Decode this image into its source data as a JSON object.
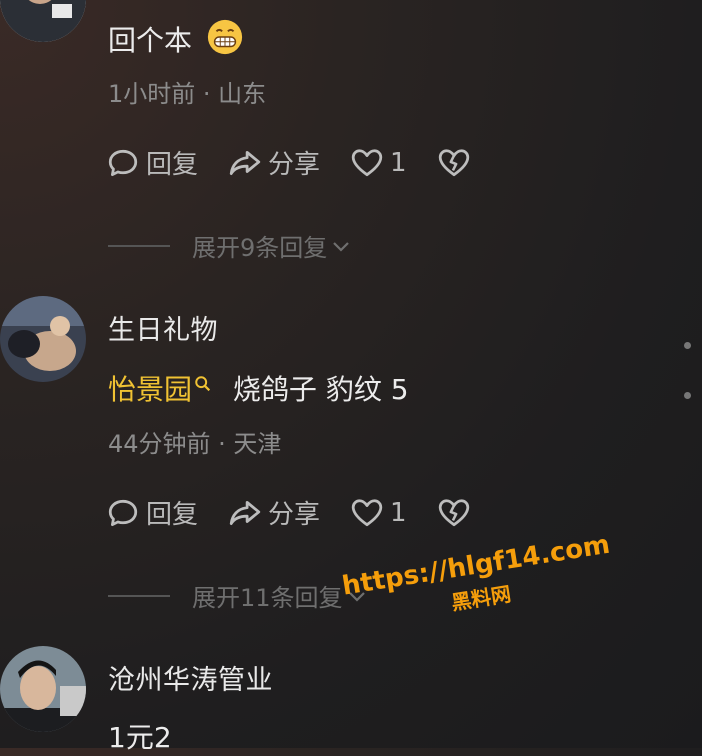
{
  "comments": [
    {
      "username": "",
      "content": "回个本",
      "meta": "1小时前 · 山东",
      "actions": {
        "reply": "回复",
        "share": "分享",
        "likes": "1"
      },
      "expand": "展开9条回复"
    },
    {
      "username": "生日礼物",
      "content_link": "怡景园",
      "content_rest": "烧鸽子 豹纹 5",
      "meta": "44分钟前 · 天津",
      "actions": {
        "reply": "回复",
        "share": "分享",
        "likes": "1"
      },
      "expand": "展开11条回复"
    },
    {
      "username": "沧州华涛管业",
      "content": "1元2"
    }
  ],
  "watermark": {
    "url": "https://hlgf14.com",
    "name": "黑料网"
  },
  "colors": {
    "link": "#f0c233",
    "watermark": "#f59e0b"
  },
  "icons": [
    "reply-bubble-icon",
    "share-arrow-icon",
    "heart-icon",
    "broken-heart-icon",
    "chevron-down-icon",
    "search-icon",
    "grin-emoji-icon"
  ]
}
